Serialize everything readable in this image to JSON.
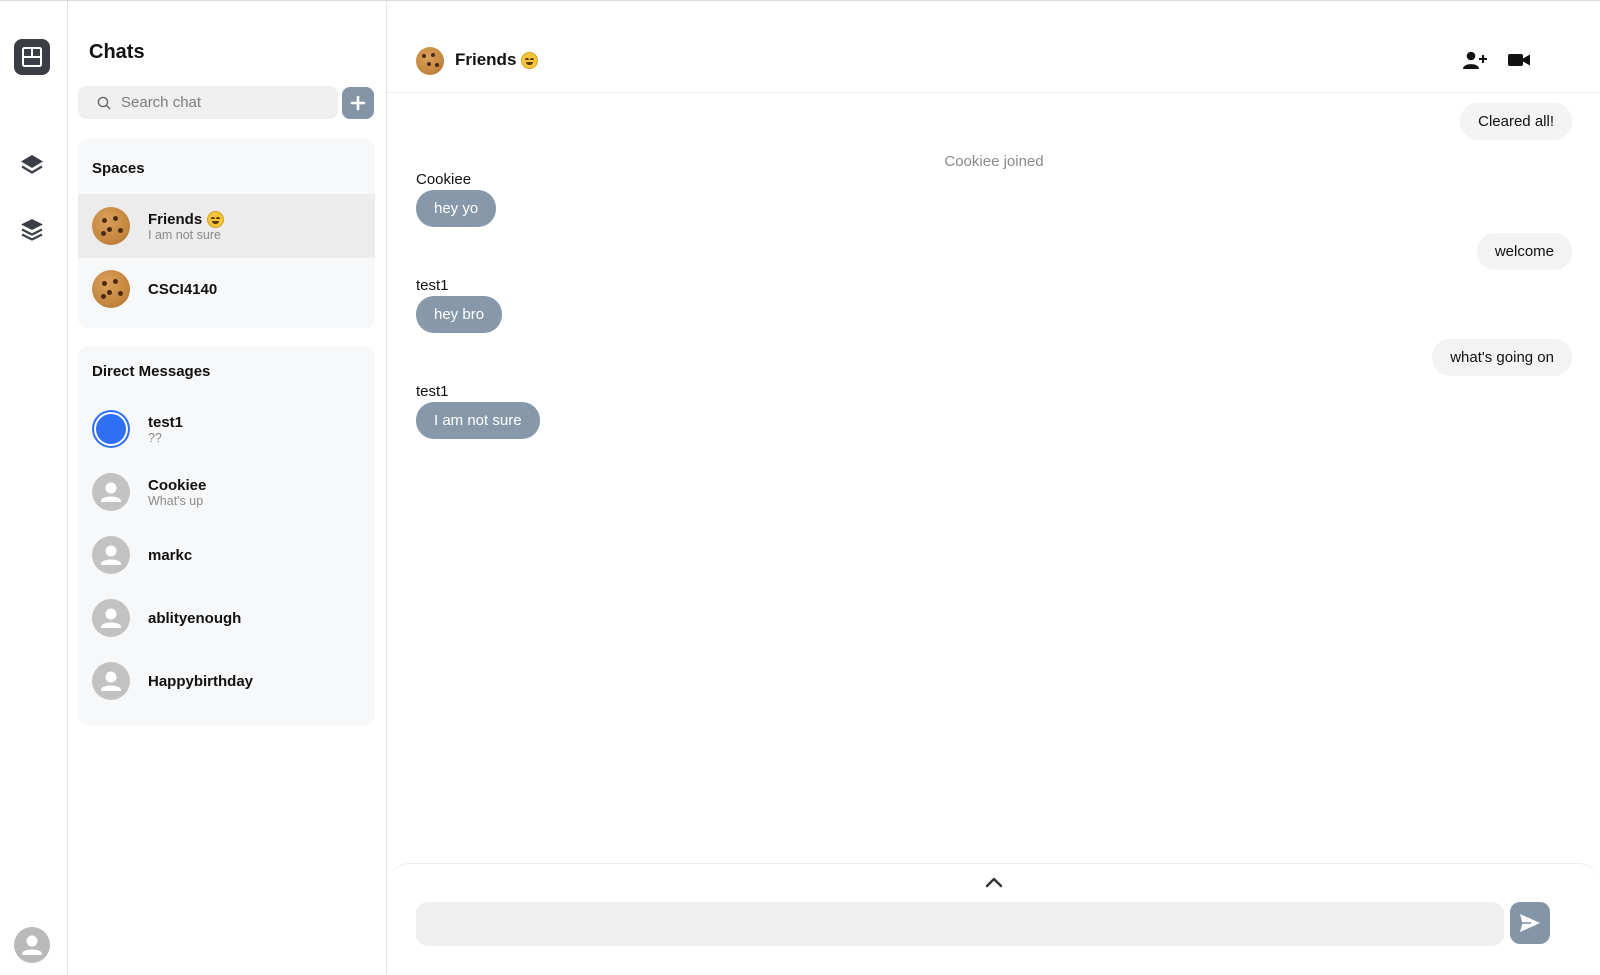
{
  "sidebar": {
    "title": "Chats",
    "search": {
      "placeholder": "Search chat",
      "value": ""
    },
    "spaces": {
      "heading": "Spaces",
      "items": [
        {
          "name": "Friends",
          "subtitle": "I am not sure",
          "active": true
        },
        {
          "name": "CSCI4140",
          "subtitle": ""
        }
      ]
    },
    "direct_messages": {
      "heading": "Direct Messages",
      "items": [
        {
          "name": "test1",
          "subtitle": "??"
        },
        {
          "name": "Cookiee",
          "subtitle": "What's up"
        },
        {
          "name": "markc",
          "subtitle": ""
        },
        {
          "name": "ablityenough",
          "subtitle": ""
        },
        {
          "name": "Happybirthday",
          "subtitle": ""
        }
      ]
    }
  },
  "chat": {
    "title": "Friends",
    "messages": [
      {
        "type": "outgoing",
        "text": "Cleared all!"
      },
      {
        "type": "system",
        "text": "Cookiee joined"
      },
      {
        "type": "incoming",
        "sender": "Cookiee",
        "text": "hey yo"
      },
      {
        "type": "outgoing",
        "text": "welcome"
      },
      {
        "type": "incoming",
        "sender": "test1",
        "text": "hey bro"
      },
      {
        "type": "outgoing",
        "text": "what's going on"
      },
      {
        "type": "incoming",
        "sender": "test1",
        "text": "I am not sure"
      }
    ],
    "composer": {
      "placeholder": "",
      "value": ""
    }
  },
  "colors": {
    "accent": "#8595a8",
    "incoming_bubble": "#8798ab",
    "outgoing_bubble": "#f3f3f4",
    "active_row": "#ececed",
    "panel_bg": "#f7f8fa"
  }
}
